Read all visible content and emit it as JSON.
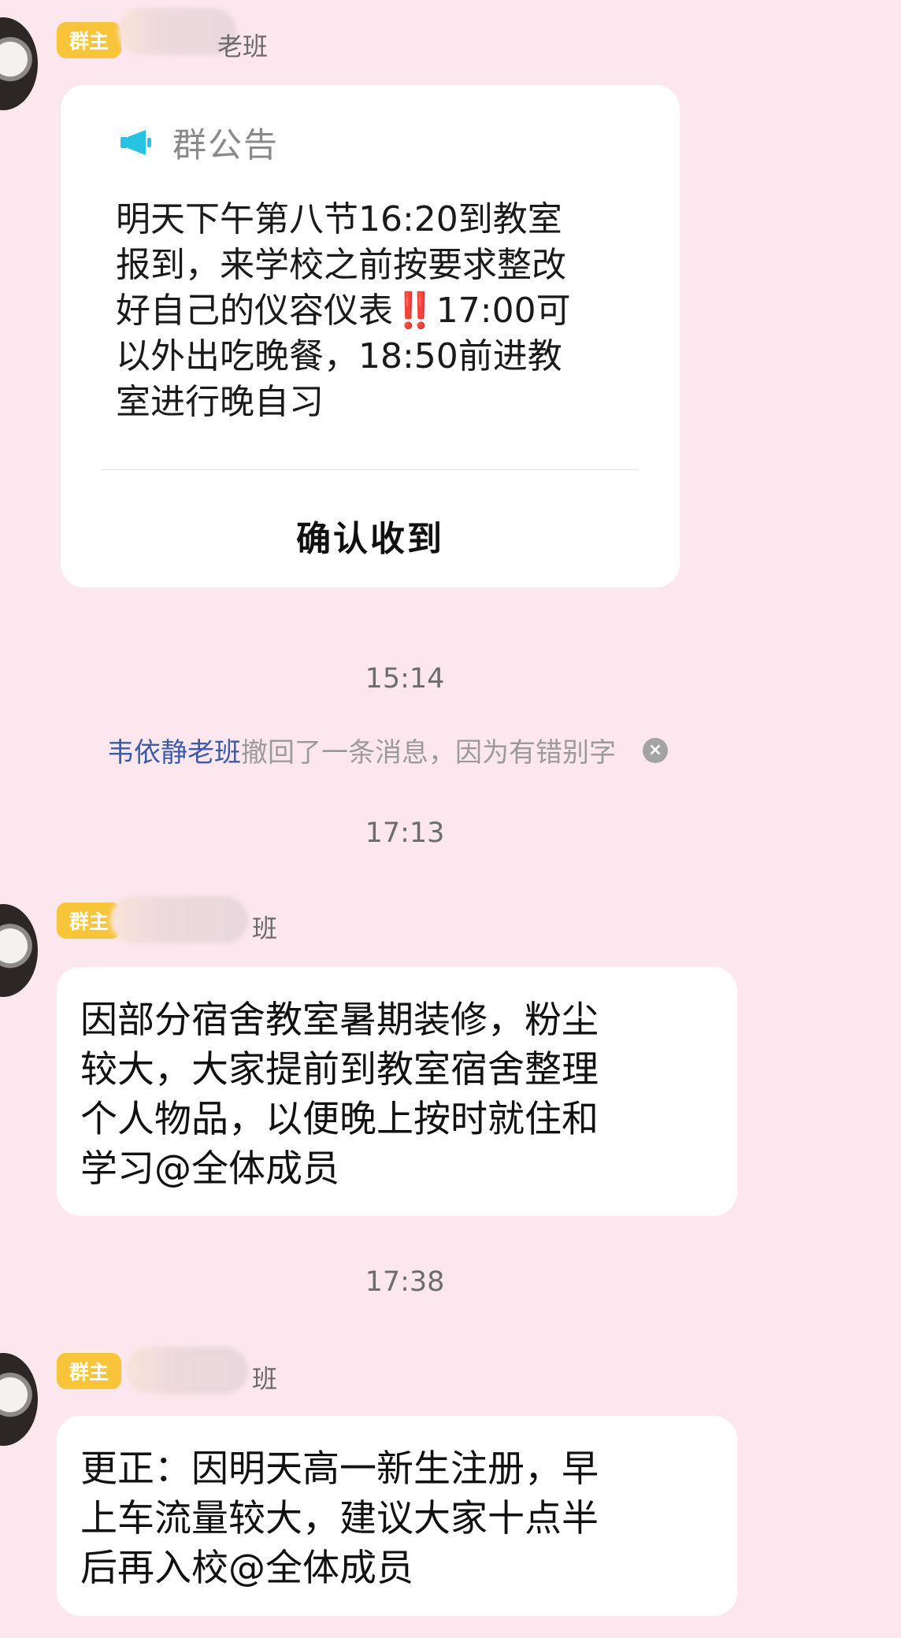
{
  "messages": [
    {
      "badge": "群主",
      "sender_suffix": "老班"
    },
    {
      "badge": "群主",
      "sender_suffix": "班"
    },
    {
      "badge": "群主",
      "sender_suffix": "班"
    }
  ],
  "announcement": {
    "title": "群公告",
    "body_lines": [
      "明天下午第八节16:20到教室",
      "报到，来学校之前按要求整改",
      "好自己的仪容仪表",
      "‼️",
      "17:00可",
      "以外出吃晚餐，18:50前进教",
      "室进行晚自习"
    ],
    "confirm_label": "确认收到"
  },
  "times": [
    "15:14",
    "17:13",
    "17:38"
  ],
  "recall": {
    "who": "韦依静老班",
    "text": "撤回了一条消息，因为有错别字",
    "dismiss": "×"
  },
  "bubble1": {
    "lines": [
      "因部分宿舍教室暑期装修，粉尘",
      "较大，大家提前到教室宿舍整理",
      "个人物品，以便晚上按时就住和",
      "学习@全体成员"
    ]
  },
  "bubble2": {
    "lines": [
      "更正：因明天高一新生注册，早",
      "上车流量较大，建议大家十点半",
      "后再入校@全体成员"
    ]
  },
  "icons": {
    "announce": "megaphone-icon",
    "dismiss": "close-circle-icon"
  },
  "colors": {
    "background": "#fde7ee",
    "badge": "#f8c53a",
    "link": "#3b5ba8"
  }
}
